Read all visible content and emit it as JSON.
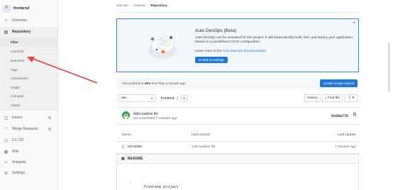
{
  "sidebar": {
    "project_initial": "F",
    "project_name": "frontend",
    "overview": "Overview",
    "repository": "Repository",
    "repo_items": [
      "Files",
      "Commits",
      "Branches",
      "Tags",
      "Contributors",
      "Graph",
      "Compare",
      "Charts"
    ],
    "issues": "Issues",
    "issues_count": "0",
    "merge_requests": "Merge Requests",
    "merge_requests_count": "0",
    "ci_cd": "CI / CD",
    "wiki": "Wiki",
    "snippets": "Snippets",
    "settings": "Settings"
  },
  "breadcrumb": [
    "web-site",
    "frontend",
    "Repository"
  ],
  "devops": {
    "title": "Auto DevOps (Beta)",
    "text": "Auto DevOps can be activated for this project. It will automatically build, test, and deploy your application based on a predefined CI/CD configuration.",
    "learn_prefix": "Learn more in the",
    "learn_link": "Auto DevOps documentation",
    "enable_button": "Enable in settings",
    "close": "×"
  },
  "push_notice": {
    "prefix": "You pushed to",
    "branch": "dev",
    "suffix": "less than a minute ago",
    "button": "Create merge request"
  },
  "toolbar": {
    "branch": "dev",
    "path": "frontend",
    "path_sep": "/",
    "plus": "+",
    "history": "History",
    "find_file": "Find file",
    "download": "⇩ ▾"
  },
  "commit": {
    "message": "Add readme file",
    "meta": "pm committed 7 minutes ago",
    "sha": "0436a775"
  },
  "files": {
    "headers": [
      "Name",
      "Last commit",
      "Last Update"
    ],
    "rows": [
      {
        "name": "README",
        "commit": "Add readme file",
        "updated": "7 minutes ago"
      }
    ]
  },
  "readme": {
    "title": "README",
    "content": "frontend project"
  },
  "colors": {
    "accent": "#1f78d1",
    "annotation_arrow": "#e8403c"
  },
  "icons": {
    "overview": "home-icon",
    "repository": "book-icon",
    "issues": "issues-icon",
    "merge_requests": "merge-request-icon",
    "ci_cd": "rocket-icon",
    "wiki": "book-icon",
    "snippets": "snippet-icon",
    "settings": "gear-icon"
  }
}
